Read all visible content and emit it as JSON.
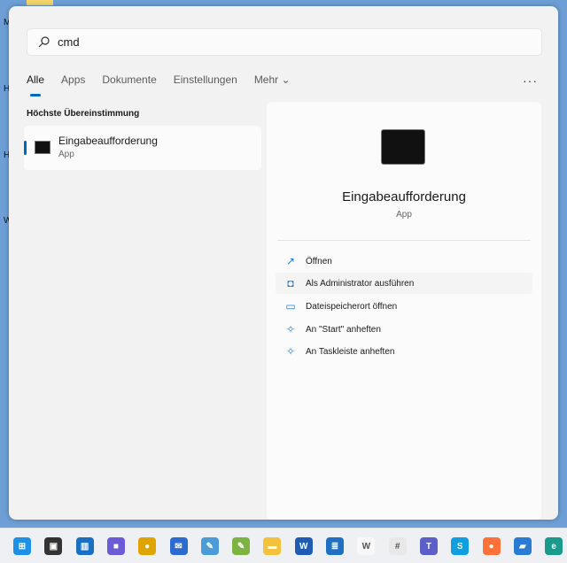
{
  "desktop": {
    "edge_letters": [
      "M",
      "H",
      "Ha",
      "W"
    ]
  },
  "search": {
    "query": "cmd"
  },
  "tabs": [
    {
      "label": "Alle"
    },
    {
      "label": "Apps"
    },
    {
      "label": "Dokumente"
    },
    {
      "label": "Einstellungen"
    },
    {
      "label": "Mehr ⌄"
    }
  ],
  "more_menu": "···",
  "section_title": "Höchste Übereinstimmung",
  "best_match": {
    "name": "Eingabeaufforderung",
    "type": "App"
  },
  "detail": {
    "name": "Eingabeaufforderung",
    "type": "App",
    "actions": [
      {
        "label": "Öffnen",
        "icon": "open-external-icon"
      },
      {
        "label": "Als Administrator ausführen",
        "icon": "shield-admin-icon"
      },
      {
        "label": "Dateispeicherort öffnen",
        "icon": "folder-icon"
      },
      {
        "label": "An \"Start\" anheften",
        "icon": "pin-icon"
      },
      {
        "label": "An Taskleiste anheften",
        "icon": "pin-icon"
      }
    ]
  },
  "taskbar": {
    "apps": [
      {
        "name": "start",
        "color": "#1e90e8",
        "glyph": "⊞"
      },
      {
        "name": "task-view",
        "color": "#333333",
        "glyph": "▣"
      },
      {
        "name": "widgets",
        "color": "#1a6fc2",
        "glyph": "▥"
      },
      {
        "name": "chat",
        "color": "#6b5bd6",
        "glyph": "■"
      },
      {
        "name": "chrome",
        "color": "#e0a400",
        "glyph": "●"
      },
      {
        "name": "thunderbird",
        "color": "#2d6bd0",
        "glyph": "✉"
      },
      {
        "name": "paint",
        "color": "#4a9bd8",
        "glyph": "✎"
      },
      {
        "name": "notepad-plus",
        "color": "#7cb342",
        "glyph": "✎"
      },
      {
        "name": "file-explorer",
        "color": "#f3c13a",
        "glyph": "▬"
      },
      {
        "name": "word",
        "color": "#1f5bb5",
        "glyph": "W"
      },
      {
        "name": "news",
        "color": "#1f6fc2",
        "glyph": "≣"
      },
      {
        "name": "wikipedia",
        "color": "#f8f8f8",
        "glyph": "W"
      },
      {
        "name": "slack",
        "color": "#e8e8e8",
        "glyph": "#"
      },
      {
        "name": "teams",
        "color": "#5b5fc7",
        "glyph": "T"
      },
      {
        "name": "skype",
        "color": "#0f9fe0",
        "glyph": "S"
      },
      {
        "name": "firefox",
        "color": "#ff7139",
        "glyph": "●"
      },
      {
        "name": "remote-desktop",
        "color": "#2a7bd4",
        "glyph": "▰"
      },
      {
        "name": "edge",
        "color": "#1a9a8a",
        "glyph": "e"
      }
    ]
  }
}
